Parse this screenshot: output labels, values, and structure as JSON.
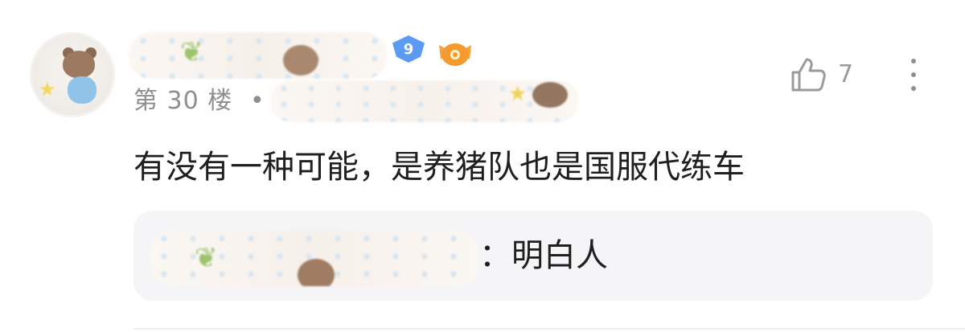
{
  "comment": {
    "floor_label": "第 30 楼",
    "separator": "•",
    "level": "9",
    "text": "有没有一种可能，是养猪队也是国服代练车",
    "like_count": "7"
  },
  "reply": {
    "separator": "：",
    "text": "明白人"
  },
  "icons": {
    "like": "thumbs-up-icon",
    "more": "more-vertical-icon",
    "level": "level-badge-icon",
    "fan": "fan-badge-icon"
  },
  "colors": {
    "primary_text": "#1f1f1f",
    "secondary_text": "#8e8e8e",
    "reply_background": "#f5f5f7",
    "level_badge": "#5b9bf4",
    "fan_badge": "#f39b2f"
  }
}
